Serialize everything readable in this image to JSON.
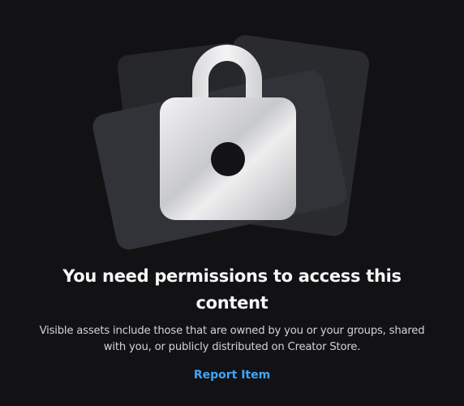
{
  "illustration": {
    "icon": "lock-icon",
    "colors": {
      "background": "#121215",
      "card_back": "#2a2b2f",
      "card_front": "#323338",
      "lock_light": "#f0f0f1",
      "lock_dark": "#a9aaad",
      "keyhole": "#131316"
    }
  },
  "message": {
    "title": "You need permissions to access this content",
    "description": "Visible assets include those that are owned by you or your groups, shared with you, or publicly distributed on Creator Store."
  },
  "actions": {
    "report_label": "Report Item",
    "link_color": "#3ea6ff"
  }
}
